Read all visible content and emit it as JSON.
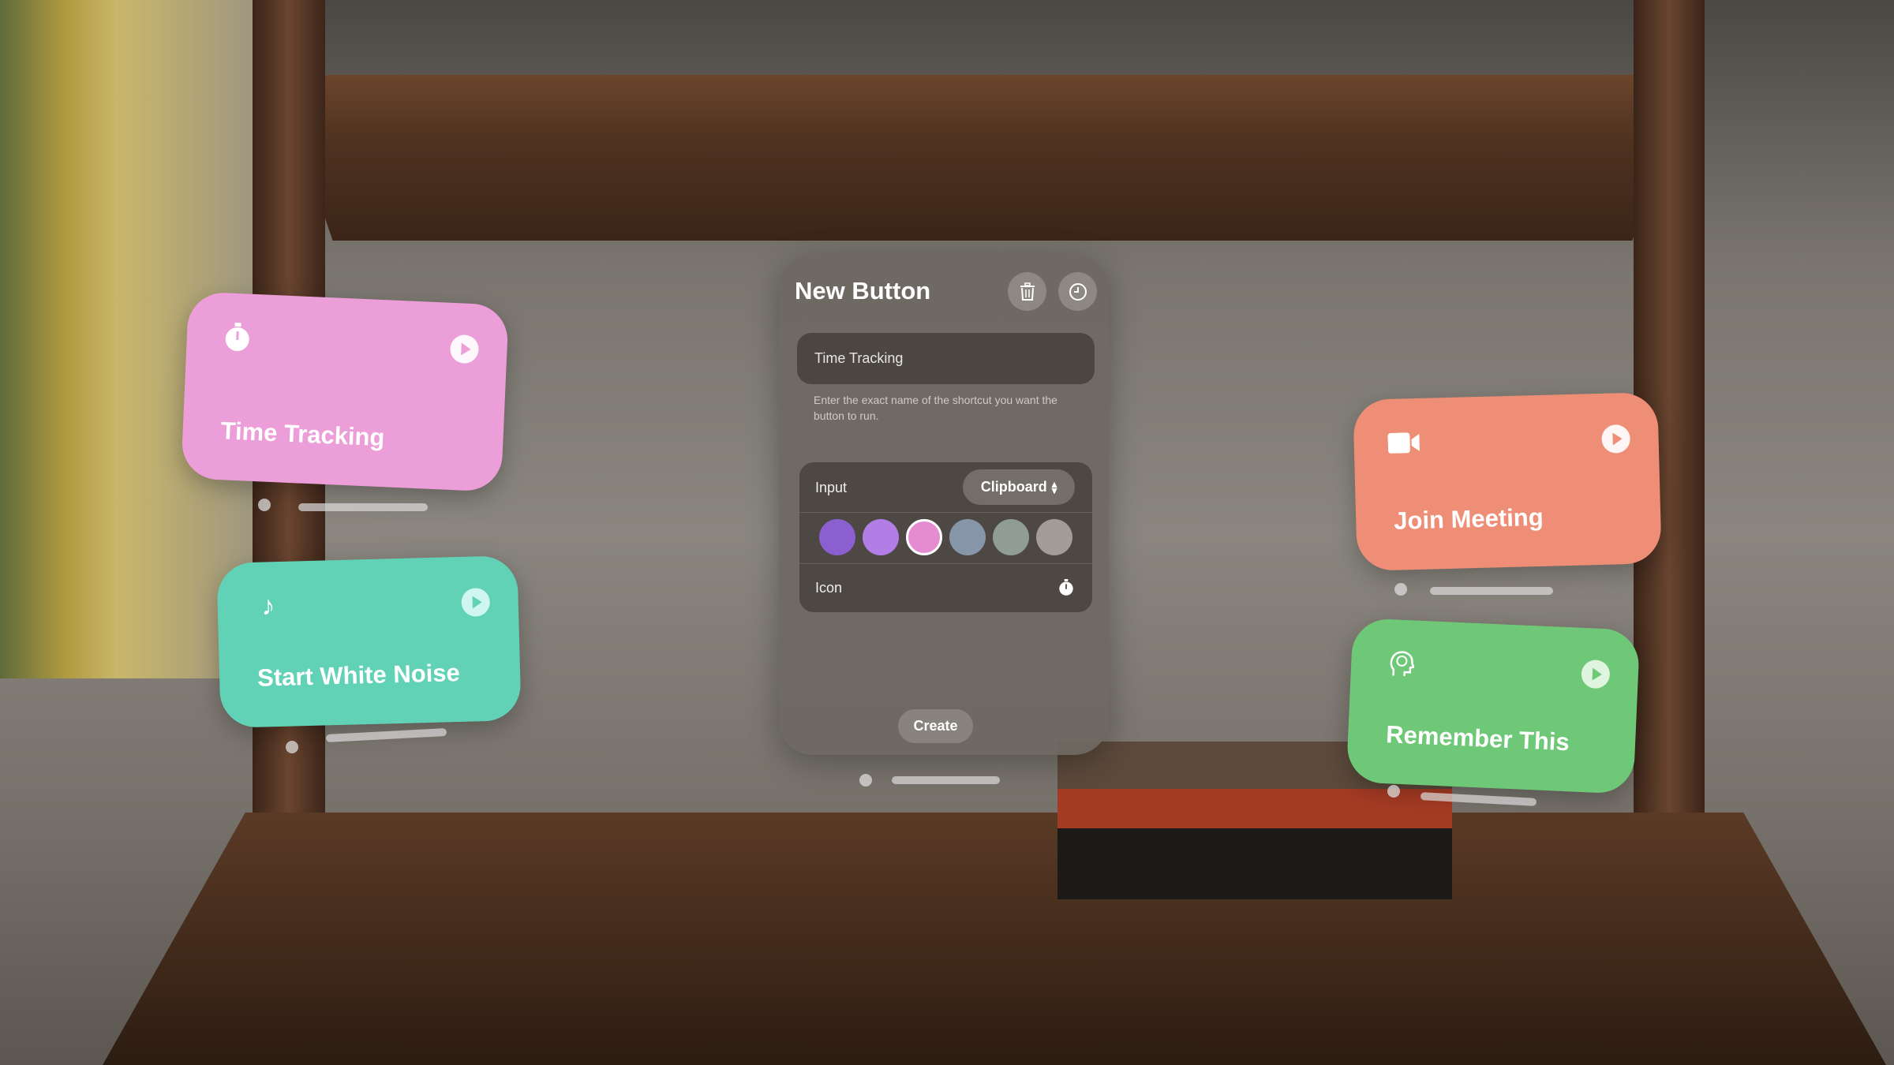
{
  "panel": {
    "title": "New Button",
    "delete_icon": "trash-icon",
    "history_icon": "clock-icon",
    "name_field_value": "Time Tracking",
    "help_text": "Enter the exact name of the shortcut you want the button to run.",
    "input_label": "Input",
    "input_value": "Clipboard",
    "colors": [
      "#8b5fd0",
      "#b27ee6",
      "#e48bd1",
      "#8696a8",
      "#909c96",
      "#a39d99"
    ],
    "selected_color_index": 2,
    "icon_label": "Icon",
    "icon_value": "stopwatch-icon",
    "create_label": "Create"
  },
  "cards": [
    {
      "label": "Time Tracking",
      "icon": "stopwatch-icon",
      "color": "#ec9ed8"
    },
    {
      "label": "Start White Noise",
      "icon": "music-note-icon",
      "color": "#62d2b6"
    },
    {
      "label": "Join Meeting",
      "icon": "video-camera-icon",
      "color": "#ef8e77"
    },
    {
      "label": "Remember This",
      "icon": "brain-head-icon",
      "color": "#6fc877"
    }
  ]
}
